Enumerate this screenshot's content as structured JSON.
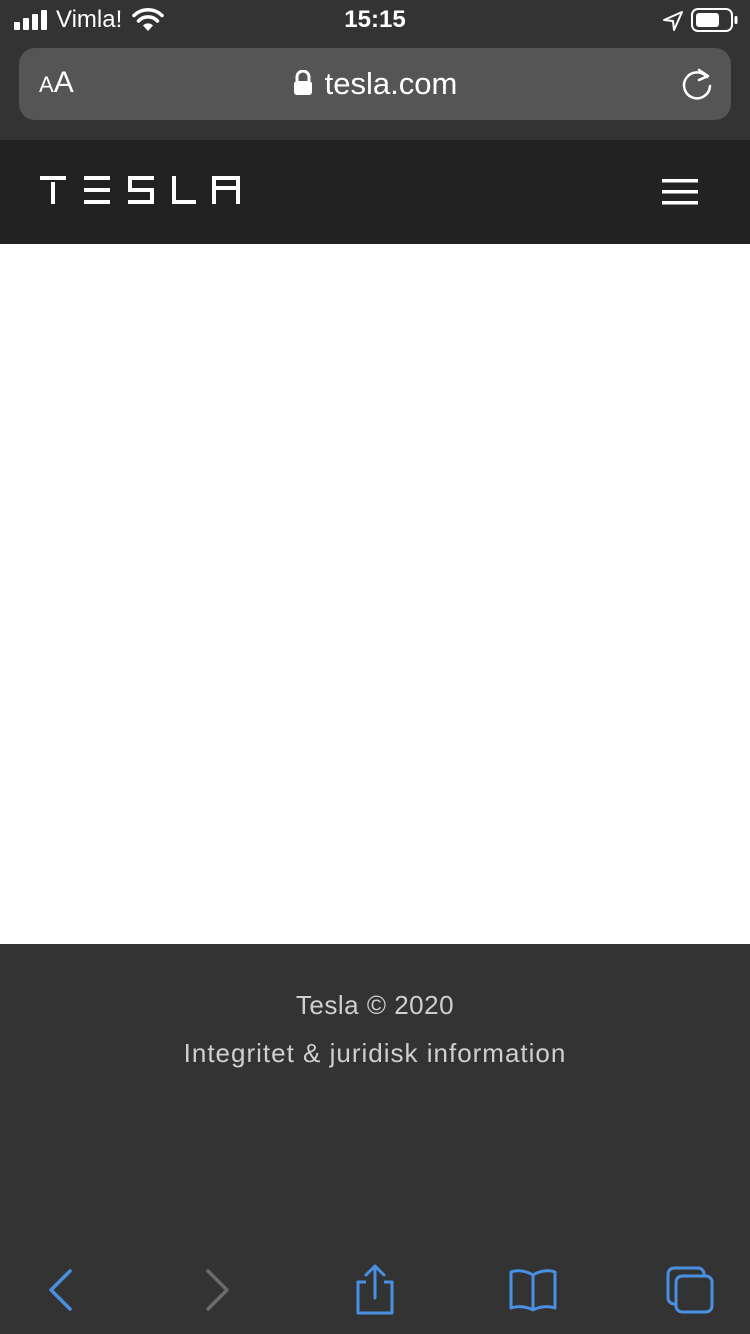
{
  "status": {
    "carrier": "Vimla!",
    "time": "15:15"
  },
  "browser": {
    "text_size_small": "A",
    "text_size_big": "A",
    "url": "tesla.com"
  },
  "site": {
    "logo_text": "TESLA"
  },
  "footer": {
    "copyright": "Tesla © 2020",
    "legal_link": "Integritet & juridisk information"
  },
  "colors": {
    "toolbar_active": "#4a90e2",
    "toolbar_disabled": "#6b6b6b",
    "nav_bg": "#222222",
    "chrome_bg": "#333333"
  }
}
